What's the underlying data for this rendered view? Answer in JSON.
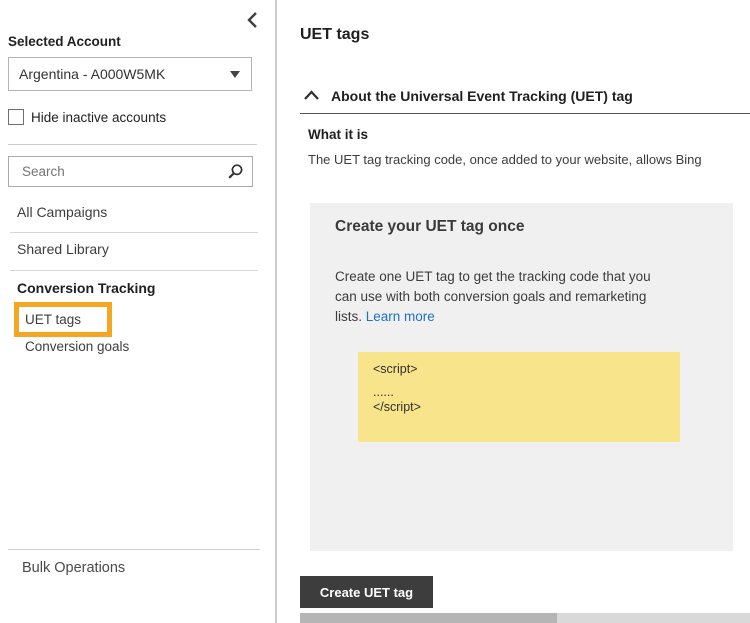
{
  "sidebar": {
    "selected_account_label": "Selected Account",
    "account_dropdown_value": "Argentina - A000W5MK",
    "hide_inactive_label": "Hide inactive accounts",
    "search_placeholder": "Search",
    "nav": [
      {
        "label": "All Campaigns"
      },
      {
        "label": "Shared Library"
      },
      {
        "label": "Conversion Tracking"
      },
      {
        "label": "UET tags",
        "highlighted": true
      },
      {
        "label": "Conversion goals"
      }
    ],
    "bulk_operations_label": "Bulk Operations"
  },
  "main": {
    "title": "UET tags",
    "about": {
      "title": "About the Universal Event Tracking (UET) tag",
      "what_it_is_heading": "What it is",
      "what_it_is_text": "The UET tag tracking code, once added to your website, allows Bing"
    },
    "card": {
      "title": "Create your UET tag once",
      "body_text": "Create one UET tag to get the tracking code that you can use with both conversion goals and remarketing lists.",
      "learn_more_label": "Learn more",
      "code_lines": [
        "<script>",
        "......",
        "</script>"
      ]
    },
    "create_button_label": "Create UET tag"
  },
  "icons": {
    "sidebar_collapse": "chevron-left",
    "account_dropdown": "caret-down",
    "search": "magnifier",
    "about_section": "chevron-up"
  },
  "colors": {
    "highlight_orange": "#F5A623",
    "link_blue": "#2272C3",
    "code_background": "#F8E58B",
    "card_background": "#F0F0F0",
    "button_background": "#3D3D3D",
    "scrollbar_thumb": "#B5B5B5",
    "scrollbar_track": "#D9D9D9"
  }
}
